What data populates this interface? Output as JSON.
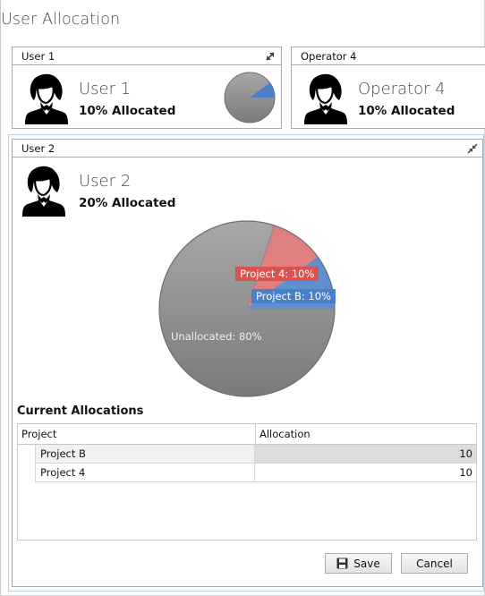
{
  "window": {
    "title": "User Allocation"
  },
  "cards": [
    {
      "header": "User 1",
      "name": "User 1",
      "allocation": "10% Allocated",
      "allocated_fraction": 0.1
    },
    {
      "header": "Operator 4",
      "name": "Operator 4",
      "allocation": "10% Allocated"
    }
  ],
  "detail": {
    "header": "User 2",
    "name": "User 2",
    "allocation": "20% Allocated",
    "pie": {
      "slices": [
        {
          "label": "Project 4: 10%",
          "value": 10,
          "color": "#e07f7f"
        },
        {
          "label": "Project B: 10%",
          "value": 10,
          "color": "#5e8fd0"
        },
        {
          "label": "Unallocated: 80%",
          "value": 80,
          "color": "#9a9a9a"
        }
      ]
    },
    "allocations_title": "Current Allocations",
    "table": {
      "columns": [
        "Project",
        "Allocation"
      ],
      "rows": [
        {
          "project": "Project B",
          "allocation": "10"
        },
        {
          "project": "Project 4",
          "allocation": "10"
        }
      ]
    },
    "buttons": {
      "save": "Save",
      "cancel": "Cancel"
    }
  },
  "colors": {
    "accent_selection": "#b9d4e6",
    "project4": "#d9534f",
    "projectB": "#4a80c8",
    "unallocated": "#8c8c8c"
  },
  "icons": [
    "user-avatar-icon",
    "expand-icon",
    "collapse-icon",
    "save-disk-icon"
  ]
}
